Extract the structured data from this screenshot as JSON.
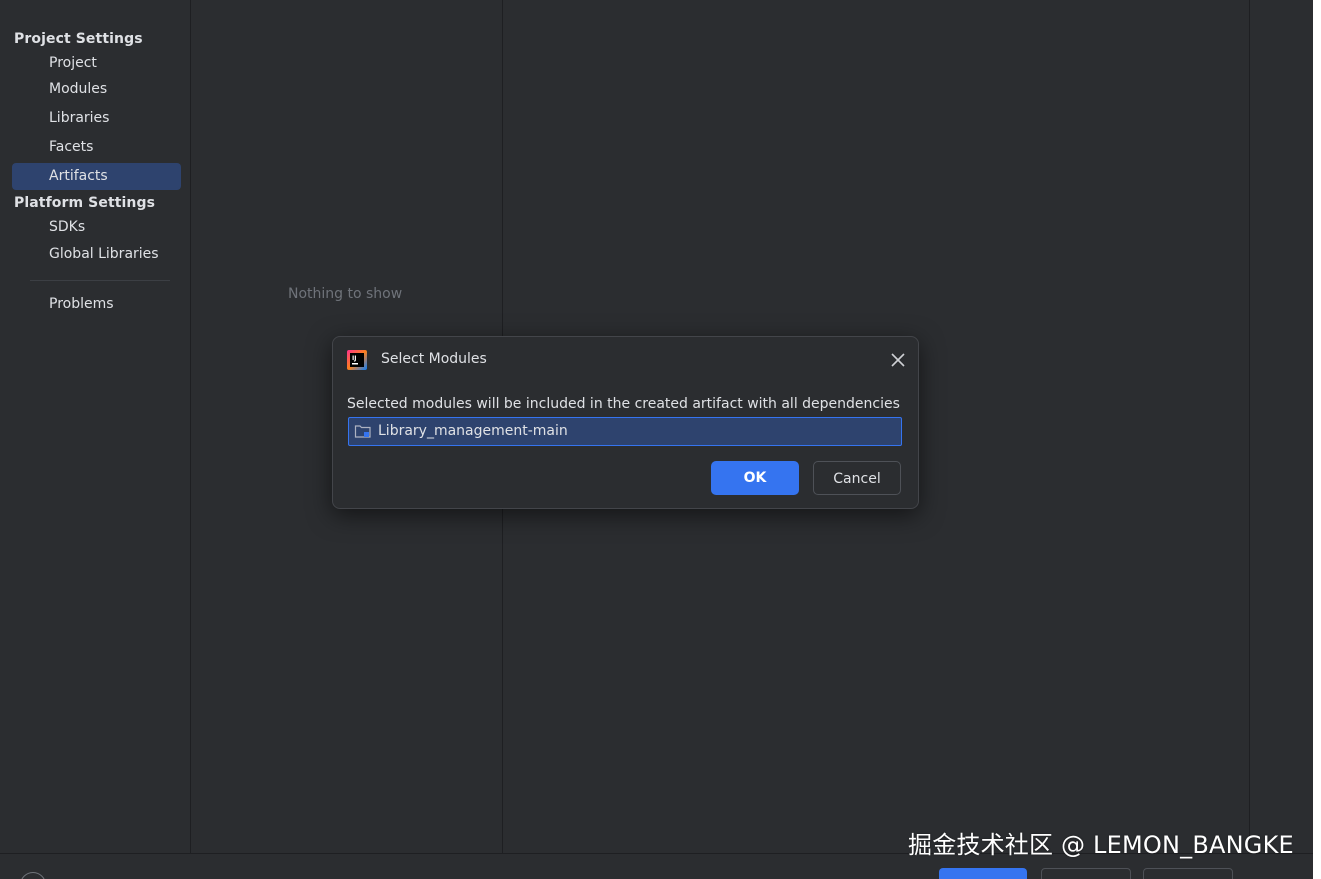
{
  "sidebar": {
    "project_settings_header": "Project Settings",
    "platform_settings_header": "Platform Settings",
    "project_items": [
      {
        "label": "Project"
      },
      {
        "label": "Modules"
      },
      {
        "label": "Libraries"
      },
      {
        "label": "Facets"
      },
      {
        "label": "Artifacts"
      }
    ],
    "platform_items": [
      {
        "label": "SDKs"
      },
      {
        "label": "Global Libraries"
      }
    ],
    "problems_label": "Problems",
    "selected": "Artifacts"
  },
  "middle_panel": {
    "empty_text": "Nothing to show"
  },
  "dialog": {
    "title": "Select Modules",
    "description": "Selected modules will be included in the created artifact with all dependencies",
    "modules": [
      {
        "name": "Library_management-main",
        "icon": "module-folder-icon",
        "selected": true
      }
    ],
    "ok_label": "OK",
    "cancel_label": "Cancel",
    "close_icon": "close-icon",
    "app_icon": "intellij-idea-icon"
  },
  "watermark": "掘金技术社区 @ LEMON_BANGKE",
  "colors": {
    "background": "#2b2d30",
    "selection": "#2e436e",
    "accent": "#3574f0",
    "text": "#dfe1e5",
    "muted_text": "#6f737a"
  }
}
